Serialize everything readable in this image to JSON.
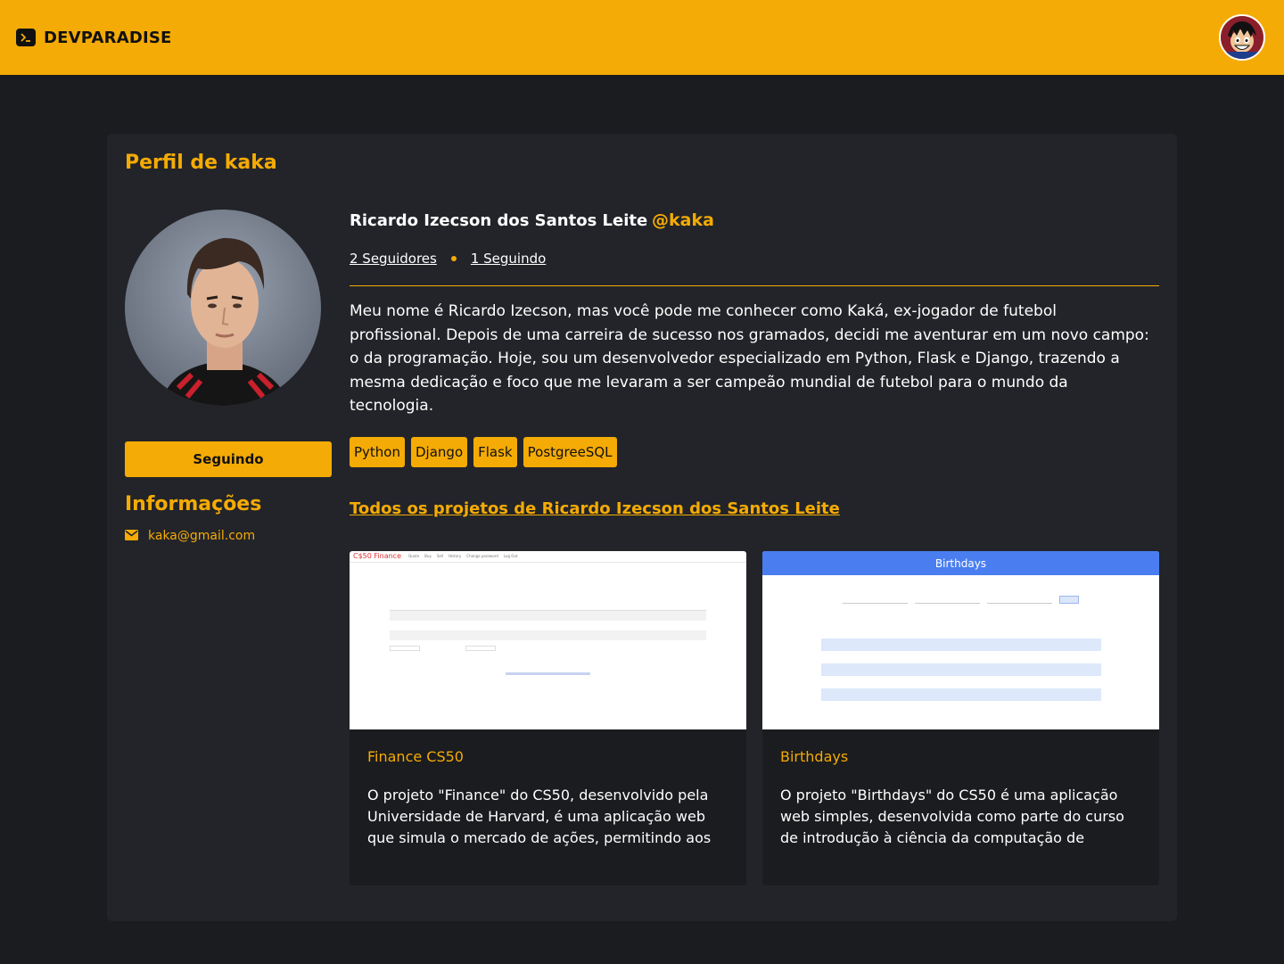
{
  "navbar": {
    "brand": "DEVPARADISE",
    "brand_icon": "terminal-icon",
    "avatar_icon": "user-avatar",
    "background": "#f5ab05"
  },
  "profile": {
    "page_title": "Perfil de kaka",
    "full_name": "Ricardo Izecson dos Santos Leite",
    "handle": "@kaka",
    "followers": "2 Seguidores",
    "following": "1 Seguindo",
    "follow_button": "Seguindo",
    "bio": "Meu nome é Ricardo Izecson, mas você pode me conhecer como Kaká, ex-jogador de futebol profissional. Depois de uma carreira de sucesso nos gramados, decidi me aventurar em um novo campo: o da programação. Hoje, sou um desenvolvedor especializado em Python, Flask e Django, trazendo a mesma dedicação e foco que me levaram a ser campeão mundial de futebol para o mundo da tecnologia.",
    "tags": [
      "Python",
      "Django",
      "Flask",
      "PostgreeSQL"
    ]
  },
  "info": {
    "title": "Informações",
    "email": "kaka@gmail.com",
    "email_icon": "mail-icon"
  },
  "projects": {
    "link": "Todos os projetos de Ricardo Izecson dos Santos Leite",
    "items": [
      {
        "title": "Finance CS50",
        "description": "O projeto \"Finance\" do CS50, desenvolvido pela Universidade de Harvard, é uma aplicação web que simula o mercado de ações, permitindo aos",
        "thumb_brand": "C$50 Finance",
        "thumb_nav": [
          "Quote",
          "Buy",
          "Sell",
          "History",
          "Change password",
          "Log Out"
        ]
      },
      {
        "title": "Birthdays",
        "description": "O projeto \"Birthdays\" do CS50 é uma aplicação web simples, desenvolvida como parte do curso de introdução à ciência da computação de",
        "thumb_header": "Birthdays"
      }
    ]
  },
  "colors": {
    "accent": "#f5ab05",
    "background": "#1b1c1f",
    "card": "#222429",
    "thumb_header_blue": "#4a7ef0"
  }
}
